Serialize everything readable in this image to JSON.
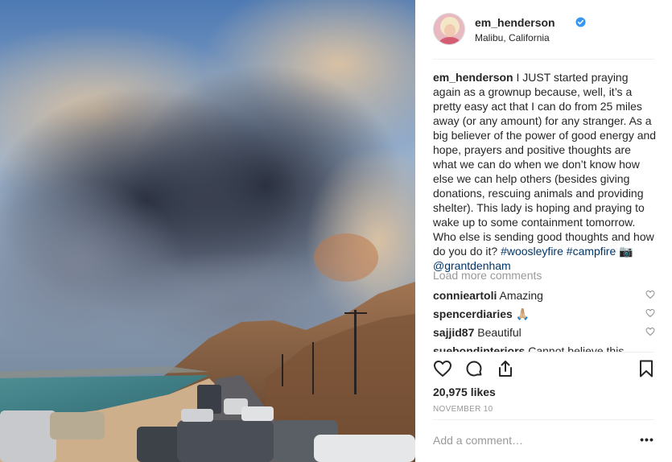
{
  "post": {
    "username": "em_henderson",
    "location": "Malibu, California",
    "verified": true,
    "caption_user": "em_henderson",
    "caption_text": "I JUST started praying again as a grownup because, well, it’s a pretty easy act that I can do from 25 miles away (or any amount) for any stranger. As a big believer of the power of good energy and hope, prayers and positive thoughts are what we can do when we don’t know how else we can help others (besides giving donations, rescuing animals and providing shelter). This lady is hoping and praying to wake up to some containment tomorrow. Who else is sending good thoughts and how do you do it?",
    "hashtags": [
      "#woosleyfire",
      "#campfire"
    ],
    "camera_emoji": "📷",
    "mention": "@grantdenham",
    "likes": "20,975 likes",
    "date": "NOVEMBER 10"
  },
  "comments_section": {
    "load_more_label": "Load more comments",
    "items": [
      {
        "user": "connieartoli",
        "text": "Amazing"
      },
      {
        "user": "spencerdiaries",
        "text": "🙏🏼"
      },
      {
        "user": "sajjid87",
        "text": "Beautiful"
      },
      {
        "user": "suebondinteriors",
        "text": "Cannot believe this"
      }
    ]
  },
  "composer": {
    "placeholder": "Add a comment…",
    "more_label": "•••"
  },
  "icons": {
    "verified": "verified-badge-icon",
    "like": "heart-icon",
    "comment": "comment-bubble-icon",
    "share": "share-icon",
    "save": "bookmark-icon"
  },
  "colors": {
    "text": "#262626",
    "muted": "#999999",
    "link": "#003569",
    "verified": "#3897f0",
    "divider": "#efefef"
  }
}
